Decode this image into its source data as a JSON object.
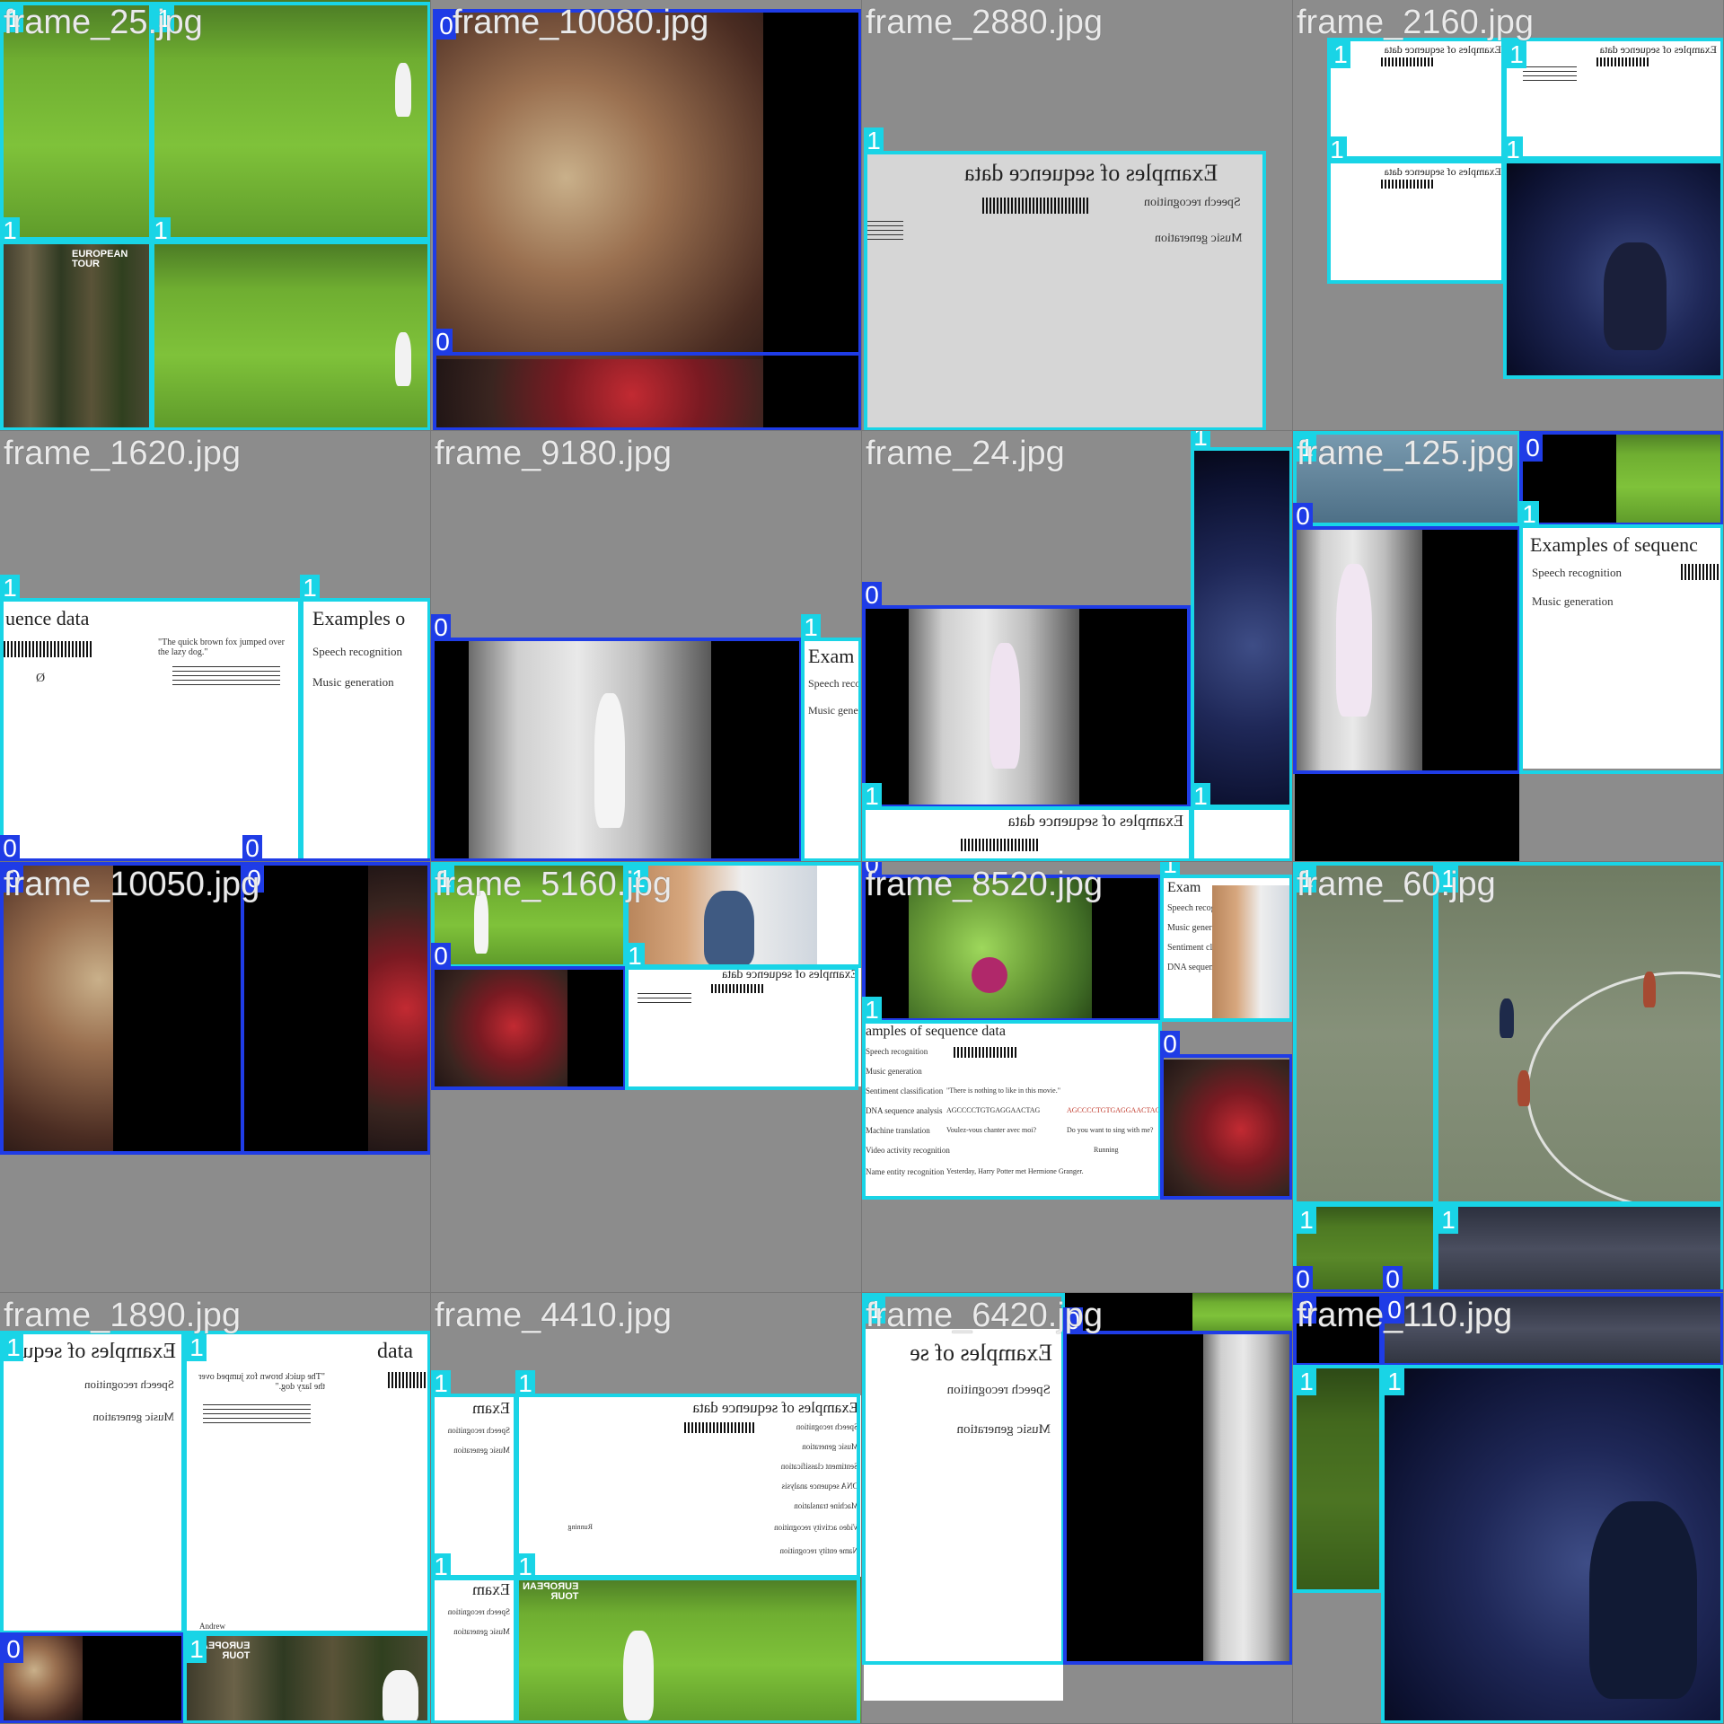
{
  "mosaic": {
    "tiles": [
      {
        "label": "frame_25.jpg"
      },
      {
        "label": "frame_10080.jpg"
      },
      {
        "label": "frame_2880.jpg"
      },
      {
        "label": "frame_2160.jpg"
      },
      {
        "label": "frame_1620.jpg"
      },
      {
        "label": "frame_9180.jpg"
      },
      {
        "label": "frame_24.jpg"
      },
      {
        "label": "frame_125.jpg"
      },
      {
        "label": "frame_10050.jpg"
      },
      {
        "label": "frame_5160.jpg"
      },
      {
        "label": "frame_8520.jpg"
      },
      {
        "label": "frame_60.jpg"
      },
      {
        "label": "frame_1890.jpg"
      },
      {
        "label": "frame_4410.jpg"
      },
      {
        "label": "frame_6420.jpg"
      },
      {
        "label": "frame_110.jpg"
      }
    ],
    "classes": {
      "c0": "0",
      "c1": "1"
    },
    "colors": {
      "class_1": "#19d4e6",
      "class_0": "#1f3ce6",
      "background": "#8c8c8c"
    }
  },
  "slide": {
    "title": "Examples of sequence data",
    "title_partial_1620": "uence data",
    "title_partial_ex": "Examples o",
    "title_short": "Exam",
    "title_partial_125": "Examples of sequenc",
    "title_partial_8520": "amples of sequence data",
    "title_partial_1890": "Examples of sequ",
    "title_partial_6420": "Examples of se",
    "title_data": "data",
    "speech": "Speech recognition",
    "music": "Music generation",
    "sentiment": "Sentiment classification",
    "dna": "DNA sequence analysis",
    "translation": "Machine translation",
    "video": "Video activity recognition",
    "entity": "Name entity recognition",
    "quote": "\"The quick brown fox jumped over the lazy dog.\"",
    "movie_quote": "\"There is nothing to like in this movie.\"",
    "dna_seq": "AGCCCCTGTGAGGAACTAG",
    "french": "Voulez-vous chanter avec moi?",
    "english": "Do you want to sing with me?",
    "running": "Running",
    "harry": "Yesterday, Harry Potter met Hermione Granger.",
    "author": "Andrew",
    "null_symbol": "Ø"
  },
  "logo": {
    "line1": "EUROPEAN",
    "line2": "TOUR"
  }
}
